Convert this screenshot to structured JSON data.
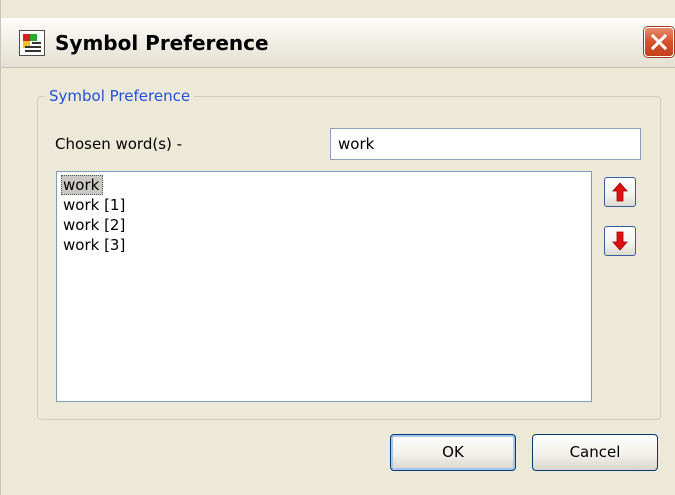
{
  "window": {
    "title": "Symbol Preference",
    "icons": {
      "app": "app-icon",
      "close": "close-icon"
    }
  },
  "group": {
    "legend": "Symbol Preference"
  },
  "chosen": {
    "label": "Chosen word(s) -",
    "value": "work"
  },
  "list": {
    "items": [
      "work",
      "work [1]",
      "work [2]",
      "work [3]"
    ],
    "selected_index": 0
  },
  "controls": {
    "move_up_icon": "arrow-up-icon",
    "move_down_icon": "arrow-down-icon"
  },
  "buttons": {
    "ok": "OK",
    "cancel": "Cancel"
  },
  "colors": {
    "legend": "#2350d8",
    "arrow": "#e01010",
    "close": "#d5512c"
  }
}
